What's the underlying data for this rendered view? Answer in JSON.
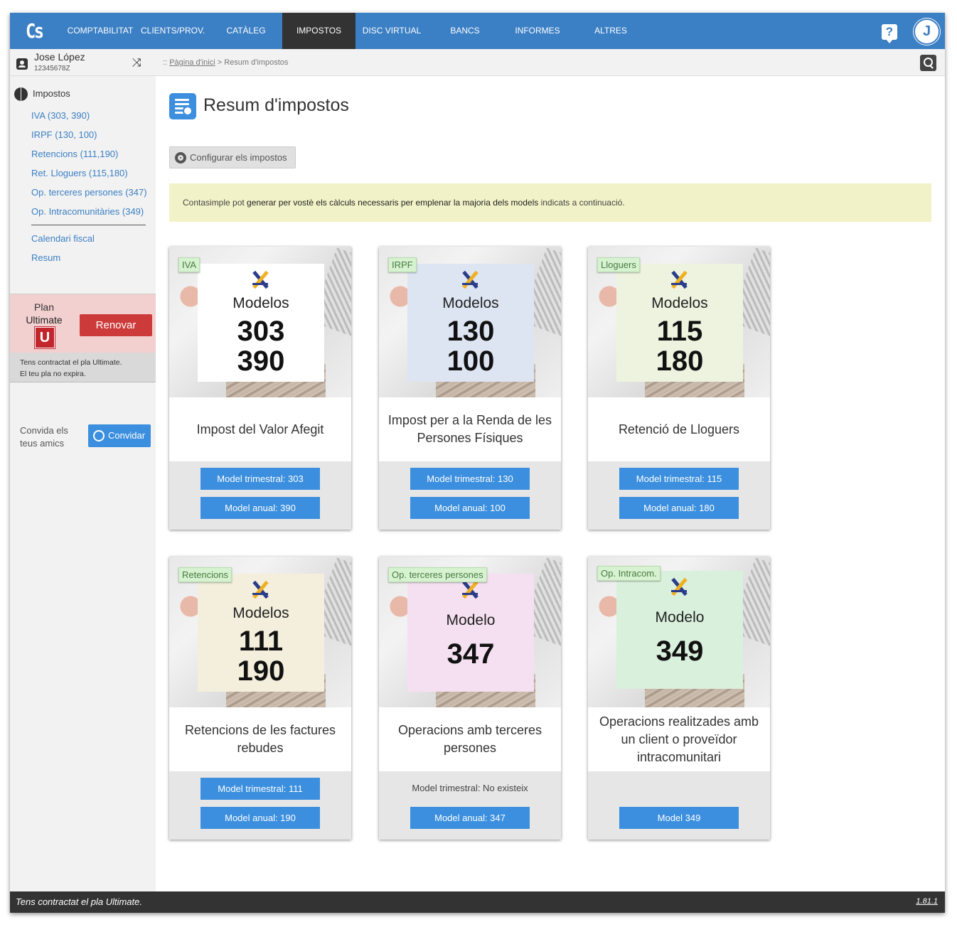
{
  "nav": {
    "logo": "Cs",
    "items": [
      {
        "label": "COMPTABILITAT"
      },
      {
        "label": "CLIENTS/PROV."
      },
      {
        "label": "CATÀLEG"
      },
      {
        "label": "IMPOSTOS",
        "active": true
      },
      {
        "label": "DISC VIRTUAL"
      },
      {
        "label": "BANCS"
      },
      {
        "label": "INFORMES"
      },
      {
        "label": "ALTRES"
      }
    ],
    "help_icon": "?",
    "avatar_initial": "J",
    "accent_color": "#3b7fc4"
  },
  "user": {
    "name": "Jose López",
    "nif": "12345678Z",
    "switch_icon": "shuffle-icon"
  },
  "breadcrumb": {
    "prefix": "::",
    "home": "Pàgina d'inici",
    "separator": ">",
    "current": "Resum d'impostos"
  },
  "sidebar": {
    "heading": "Impostos",
    "links": [
      {
        "label": "IVA (303, 390)"
      },
      {
        "label": "IRPF (130, 100)"
      },
      {
        "label": "Retencions (111,190)"
      },
      {
        "label": "Ret. Lloguers (115,180)"
      },
      {
        "label": "Op. terceres persones (347)"
      },
      {
        "label": "Op. Intracomunitàries (349)"
      },
      {
        "label": "Calendari fiscal"
      },
      {
        "label": "Resum"
      }
    ],
    "plan": {
      "label": "Plan",
      "name": "Ultimate",
      "badge": "U",
      "renew": "Renovar",
      "note_line1": "Tens contractat el pla Ultimate.",
      "note_line2": "El teu pla no expira."
    },
    "invite": {
      "text": "Convida els teus amics",
      "button": "Convidar"
    }
  },
  "main": {
    "title": "Resum d'impostos",
    "config_button": "Configurar els impostos",
    "info": {
      "pre": "Contasimple pot ",
      "bold": "generar per vostè els càlculs necessaris per emplenar la majoria dels models",
      "post": " indicats a continuació."
    },
    "cards": [
      {
        "tag": "IVA",
        "paper_color": "#ffffff",
        "heading": "Modelos",
        "numbers": [
          "303",
          "390"
        ],
        "description": "Impost del Valor Afegit",
        "quarterly": "Model trimestral: 303",
        "annual": "Model anual: 390"
      },
      {
        "tag": "IRPF",
        "paper_color": "#dde5f3",
        "heading": "Modelos",
        "numbers": [
          "130",
          "100"
        ],
        "description": "Impost per a la Renda de les Persones Físiques",
        "quarterly": "Model trimestral: 130",
        "annual": "Model anual: 100"
      },
      {
        "tag": "Lloguers",
        "paper_color": "#eef3e0",
        "heading": "Modelos",
        "numbers": [
          "115",
          "180"
        ],
        "description": "Retenció de Lloguers",
        "quarterly": "Model trimestral: 115",
        "annual": "Model anual: 180"
      },
      {
        "tag": "Retencions",
        "paper_color": "#f3efdc",
        "heading": "Modelos",
        "numbers": [
          "111",
          "190"
        ],
        "description": "Retencions de les factures rebudes",
        "quarterly": "Model trimestral: 111",
        "annual": "Model anual: 190"
      },
      {
        "tag": "Op. terceres persones",
        "paper_color": "#f5e0f1",
        "heading": "Modelo",
        "numbers": [
          "347"
        ],
        "description": "Operacions amb terceres persones",
        "quarterly_note": "Model trimestral: No existeix",
        "annual": "Model anual: 347"
      },
      {
        "tag": "Op. Intracom.",
        "paper_color": "#d9f0dc",
        "heading": "Modelo",
        "numbers": [
          "349"
        ],
        "description": "Operacions realitzades amb un client o proveïdor intracomunitari",
        "annual": "Model 349"
      }
    ]
  },
  "footer": {
    "text": "Tens contractat el pla Ultimate.",
    "version": "1.81.1"
  }
}
